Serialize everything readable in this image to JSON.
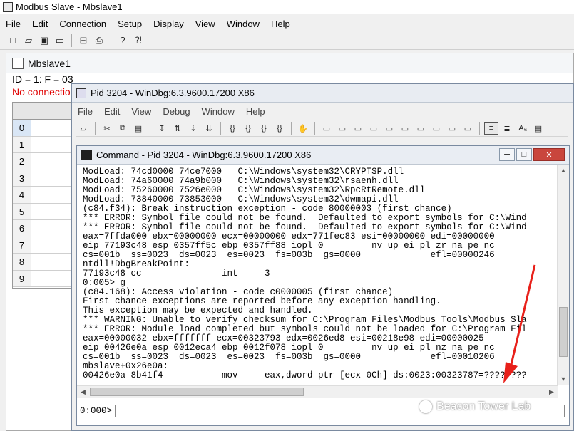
{
  "app": {
    "title": "Modbus Slave - Mbslave1",
    "menu": [
      "File",
      "Edit",
      "Connection",
      "Setup",
      "Display",
      "View",
      "Window",
      "Help"
    ],
    "toolbar_icons": [
      "new-icon",
      "open-icon",
      "save-icon",
      "window-icon",
      "monitor-icon",
      "print-icon",
      "help-icon",
      "context-help-icon"
    ]
  },
  "mbslave": {
    "title": "Mbslave1",
    "id_line": "ID = 1: F = 03",
    "status": "No connection",
    "rows": [
      "0",
      "1",
      "2",
      "3",
      "4",
      "5",
      "6",
      "7",
      "8",
      "9"
    ]
  },
  "windbg": {
    "title": "Pid 3204 - WinDbg:6.3.9600.17200 X86",
    "menu": [
      "File",
      "Edit",
      "View",
      "Debug",
      "Window",
      "Help"
    ],
    "command": {
      "title": "Command - Pid 3204 - WinDbg:6.3.9600.17200 X86",
      "lines": [
        "ModLoad: 74cd0000 74ce7000   C:\\Windows\\system32\\CRYPTSP.dll",
        "ModLoad: 74a60000 74a9b000   C:\\Windows\\system32\\rsaenh.dll",
        "ModLoad: 75260000 7526e000   C:\\Windows\\system32\\RpcRtRemote.dll",
        "ModLoad: 73840000 73853000   C:\\Windows\\system32\\dwmapi.dll",
        "(c84.f34): Break instruction exception - code 80000003 (first chance)",
        "*** ERROR: Symbol file could not be found.  Defaulted to export symbols for C:\\Wind",
        "*** ERROR: Symbol file could not be found.  Defaulted to export symbols for C:\\Wind",
        "eax=7ffda000 ebx=00000000 ecx=00000000 edx=771fec83 esi=00000000 edi=00000000",
        "eip=77193c48 esp=0357ff5c ebp=0357ff88 iopl=0         nv up ei pl zr na pe nc",
        "cs=001b  ss=0023  ds=0023  es=0023  fs=003b  gs=0000             efl=00000246",
        "ntdll!DbgBreakPoint:",
        "77193c48 cc               int     3",
        "0:005> g",
        "(c84.168): Access violation - code c0000005 (first chance)",
        "First chance exceptions are reported before any exception handling.",
        "This exception may be expected and handled.",
        "*** WARNING: Unable to verify checksum for C:\\Program Files\\Modbus Tools\\Modbus Sla",
        "*** ERROR: Module load completed but symbols could not be loaded for C:\\Program Fil",
        "eax=00000032 ebx=fffffff ecx=00323793 edx=0026ed8 esi=00218e98 edi=00000025",
        "eip=00426e0a esp=0012eca4 ebp=0012f078 iopl=0         nv up ei pl nz na pe nc",
        "cs=001b  ss=0023  ds=0023  es=0023  fs=003b  gs=0000             efl=00010206",
        "mbslave+0x26e0a:",
        "00426e0a 8b41f4           mov     eax,dword ptr [ecx-0Ch] ds:0023:00323787=????????"
      ],
      "prompt": "0:000>",
      "input_value": ""
    }
  },
  "watermark": "Beacon Tower Lab",
  "annotation_color": "#e8201a"
}
